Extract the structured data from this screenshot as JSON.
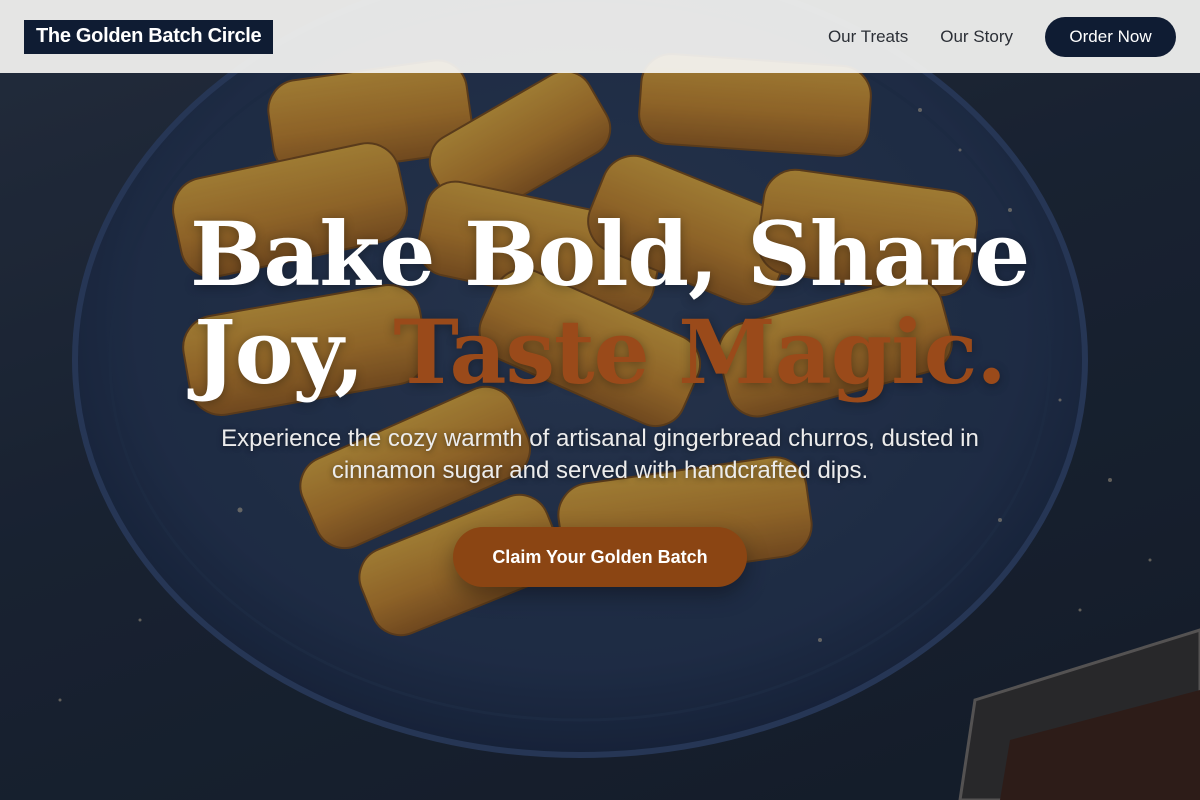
{
  "header": {
    "logo": "The Golden Batch Circle",
    "nav": [
      {
        "label": "Our Treats"
      },
      {
        "label": "Our Story"
      }
    ],
    "order_label": "Order Now"
  },
  "hero": {
    "headline_line1": "Bake Bold, Share",
    "headline_line2_plain": "Joy, ",
    "headline_line2_accent": "Taste Magic.",
    "subhead": "Experience the cozy warmth of artisanal gingerbread churros, dusted in cinnamon sugar and served with handcrafted dips.",
    "cta_label": "Claim Your Golden Batch"
  },
  "colors": {
    "navy": "#0f1c33",
    "accent": "#8b4513",
    "header_bg": "#f4f4f2"
  }
}
